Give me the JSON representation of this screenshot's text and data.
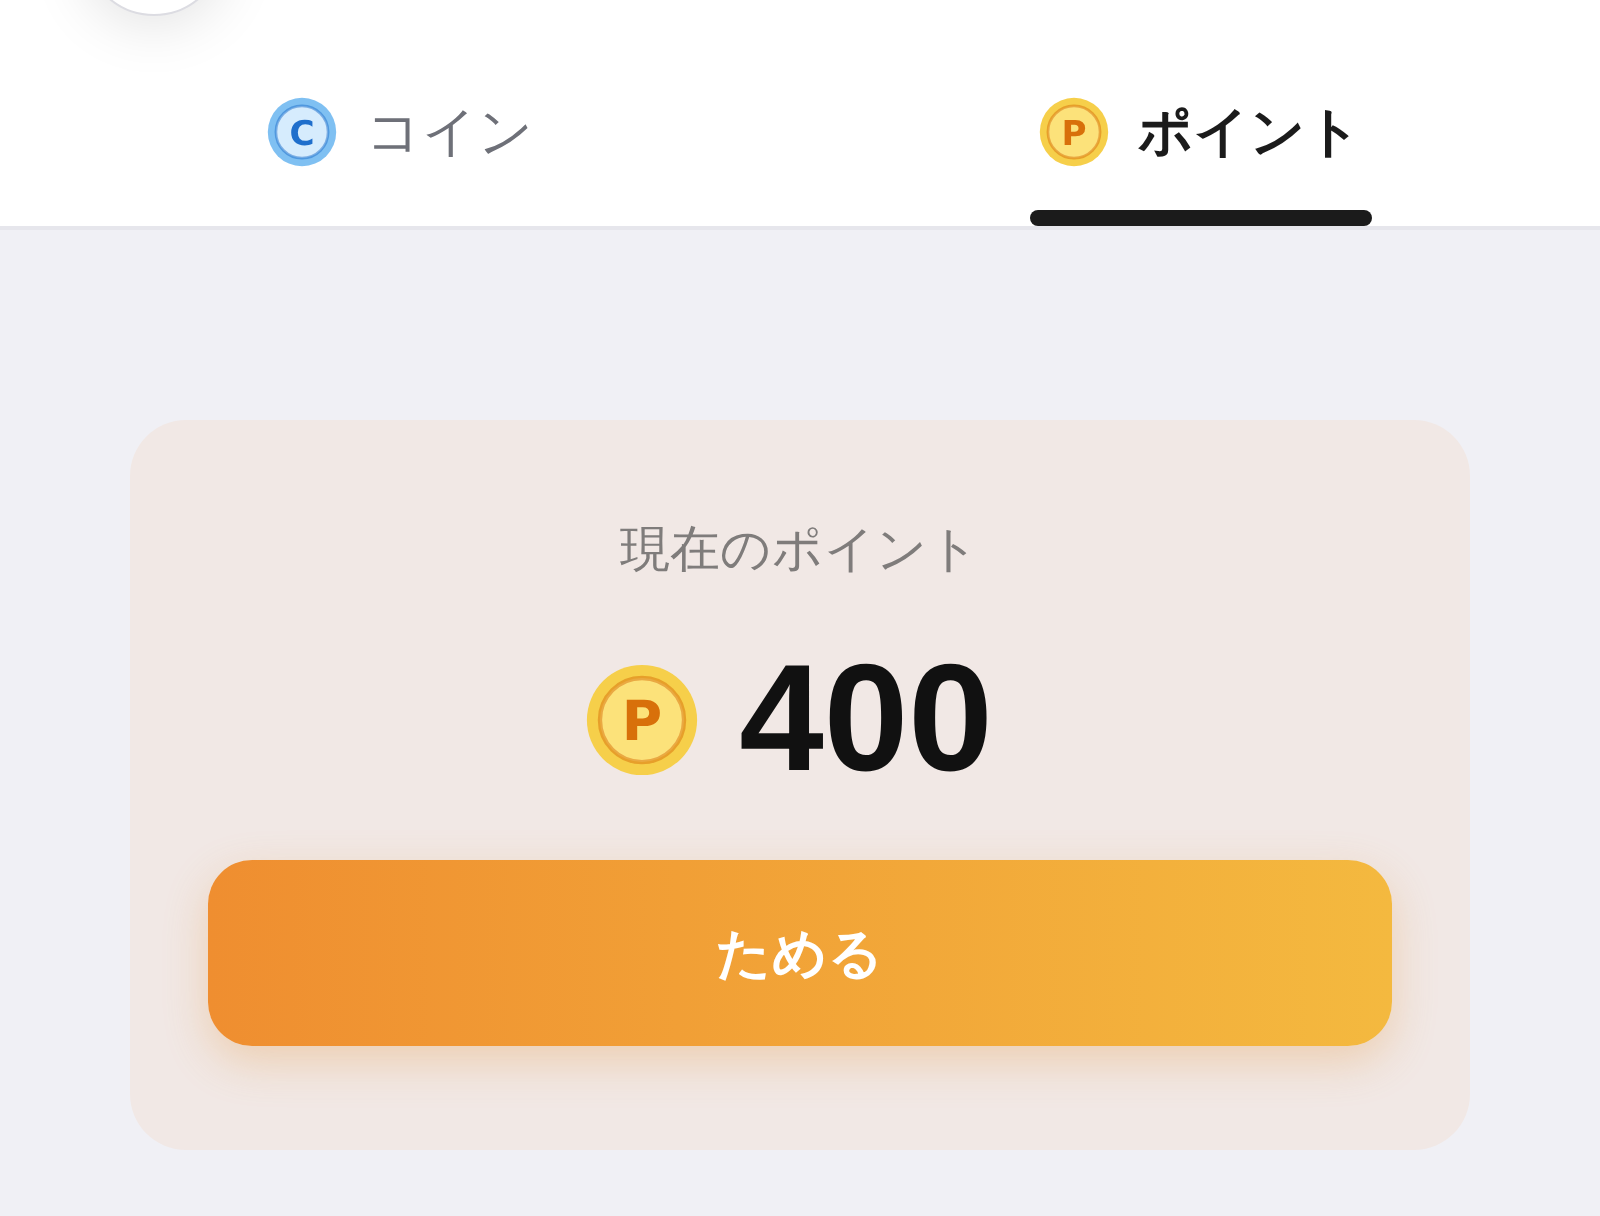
{
  "tabs": [
    {
      "label": "コイン",
      "icon_letter": "C",
      "kind": "coin",
      "selected": false
    },
    {
      "label": "ポイント",
      "icon_letter": "P",
      "kind": "point",
      "selected": true
    }
  ],
  "card": {
    "label": "現在のポイント",
    "icon_letter": "P",
    "amount": "400",
    "button": "ためる"
  }
}
